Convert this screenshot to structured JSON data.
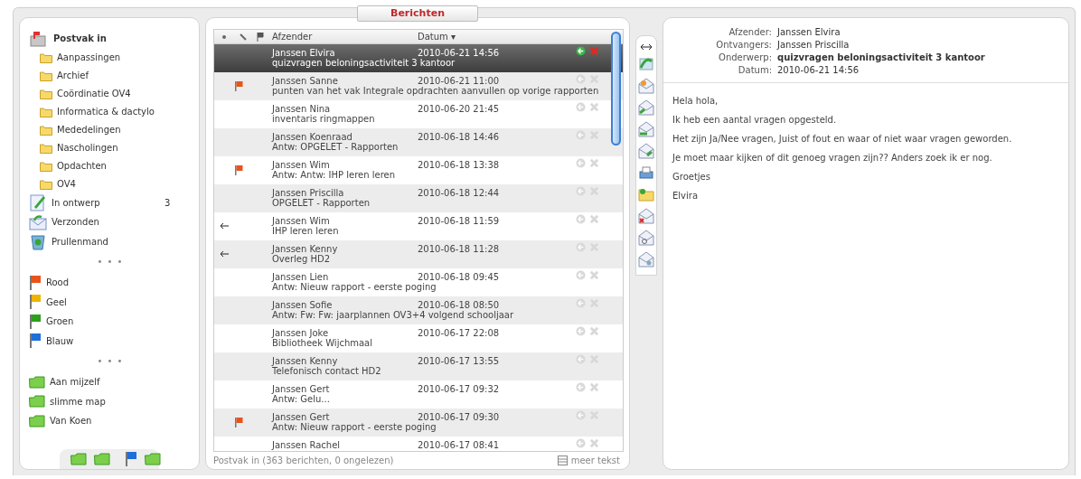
{
  "sidebar": {
    "items": [
      {
        "kind": "inbox",
        "label": "Postvak in",
        "children": [
          {
            "kind": "folder",
            "label": "Aanpassingen"
          },
          {
            "kind": "folder",
            "label": "Archief"
          },
          {
            "kind": "folder",
            "label": "Coördinatie OV4"
          },
          {
            "kind": "folder",
            "label": "Informatica & dactylo"
          },
          {
            "kind": "folder",
            "label": "Mededelingen"
          },
          {
            "kind": "folder",
            "label": "Nascholingen"
          },
          {
            "kind": "folder",
            "label": "Opdachten"
          },
          {
            "kind": "folder",
            "label": "OV4"
          }
        ]
      },
      {
        "kind": "drafts",
        "label": "In ontwerp",
        "count": "3"
      },
      {
        "kind": "sent",
        "label": "Verzonden"
      },
      {
        "kind": "trash",
        "label": "Prullenmand"
      },
      {
        "kind": "separator",
        "label": "• • •"
      },
      {
        "kind": "flag",
        "label": "Rood",
        "color": "#e8541c"
      },
      {
        "kind": "flag",
        "label": "Geel",
        "color": "#f0b400"
      },
      {
        "kind": "flag",
        "label": "Groen",
        "color": "#2e9e1e"
      },
      {
        "kind": "flag",
        "label": "Blauw",
        "color": "#1f6fd8"
      },
      {
        "kind": "separator",
        "label": "• • •"
      },
      {
        "kind": "smart",
        "label": "Aan mijzelf"
      },
      {
        "kind": "smart",
        "label": "slimme map"
      },
      {
        "kind": "smart",
        "label": "Van Koen"
      }
    ]
  },
  "messages": {
    "tab": "Berichten",
    "columns": [
      "Afzender",
      "Datum"
    ],
    "sort_mark": "▾",
    "rows": [
      {
        "sender": "Janssen Elvira",
        "date": "2010-06-21 14:56",
        "subject": "quizvragen beloningsactiviteit 3 kantoor",
        "flagged": false,
        "replied": false,
        "selected": true
      },
      {
        "sender": "Janssen Sanne",
        "date": "2010-06-21 11:00",
        "subject": "punten van het vak Integrale opdrachten aanvullen op vorige rapporten",
        "flagged": true,
        "replied": false,
        "selected": false
      },
      {
        "sender": "Janssen Nina",
        "date": "2010-06-20 21:45",
        "subject": "inventaris ringmappen",
        "flagged": false,
        "replied": false,
        "selected": false
      },
      {
        "sender": "Janssen Koenraad",
        "date": "2010-06-18 14:46",
        "subject": "Antw: OPGELET - Rapporten",
        "flagged": false,
        "replied": false,
        "selected": false
      },
      {
        "sender": "Janssen Wim",
        "date": "2010-06-18 13:38",
        "subject": "Antw: Antw: IHP leren leren",
        "flagged": true,
        "replied": false,
        "selected": false
      },
      {
        "sender": "Janssen Priscilla",
        "date": "2010-06-18 12:44",
        "subject": "OPGELET - Rapporten",
        "flagged": false,
        "replied": false,
        "selected": false
      },
      {
        "sender": "Janssen Wim",
        "date": "2010-06-18 11:59",
        "subject": "IHP leren leren",
        "flagged": false,
        "replied": true,
        "selected": false
      },
      {
        "sender": "Janssen Kenny",
        "date": "2010-06-18 11:28",
        "subject": "Overleg HD2",
        "flagged": false,
        "replied": true,
        "selected": false
      },
      {
        "sender": "Janssen Lien",
        "date": "2010-06-18 09:45",
        "subject": "Antw: Nieuw rapport - eerste poging",
        "flagged": false,
        "replied": false,
        "selected": false
      },
      {
        "sender": "Janssen Sofie",
        "date": "2010-06-18 08:50",
        "subject": "Antw: Fw: Fw: jaarplannen OV3+4 volgend schooljaar",
        "flagged": false,
        "replied": false,
        "selected": false
      },
      {
        "sender": "Janssen Joke",
        "date": "2010-06-17 22:08",
        "subject": "Bibliotheek Wijchmaal",
        "flagged": false,
        "replied": false,
        "selected": false
      },
      {
        "sender": "Janssen Kenny",
        "date": "2010-06-17 13:55",
        "subject": "Telefonisch contact HD2",
        "flagged": false,
        "replied": false,
        "selected": false
      },
      {
        "sender": "Janssen Gert",
        "date": "2010-06-17 09:32",
        "subject": "Antw: Gelu...",
        "flagged": false,
        "replied": false,
        "selected": false
      },
      {
        "sender": "Janssen Gert",
        "date": "2010-06-17 09:30",
        "subject": "Antw: Nieuw rapport - eerste poging",
        "flagged": true,
        "replied": false,
        "selected": false
      },
      {
        "sender": "Janssen Rachel",
        "date": "2010-06-17 08:41",
        "flagged": false,
        "replied": false,
        "selected": false
      }
    ],
    "status": "Postvak in (363 berichten, 0 ongelezen)",
    "more_text": "meer tekst"
  },
  "preview": {
    "headers": [
      {
        "label": "Afzender:",
        "value": "Janssen Elvira",
        "bold": false
      },
      {
        "label": "Ontvangers:",
        "value": "Janssen Priscilla",
        "bold": false
      },
      {
        "label": "Onderwerp:",
        "value": "quizvragen beloningsactiviteit 3 kantoor",
        "bold": true
      },
      {
        "label": "Datum:",
        "value": "2010-06-21 14:56",
        "bold": false
      }
    ],
    "body": [
      "Hela hola,",
      "Ik heb een aantal vragen opgesteld.",
      "Het zijn Ja/Nee vragen, Juist of fout en waar of niet waar vragen geworden.",
      "Je moet maar kijken of dit genoeg vragen zijn?? Anders zoek ik er nog.",
      "Groetjes",
      "Elvira"
    ]
  }
}
